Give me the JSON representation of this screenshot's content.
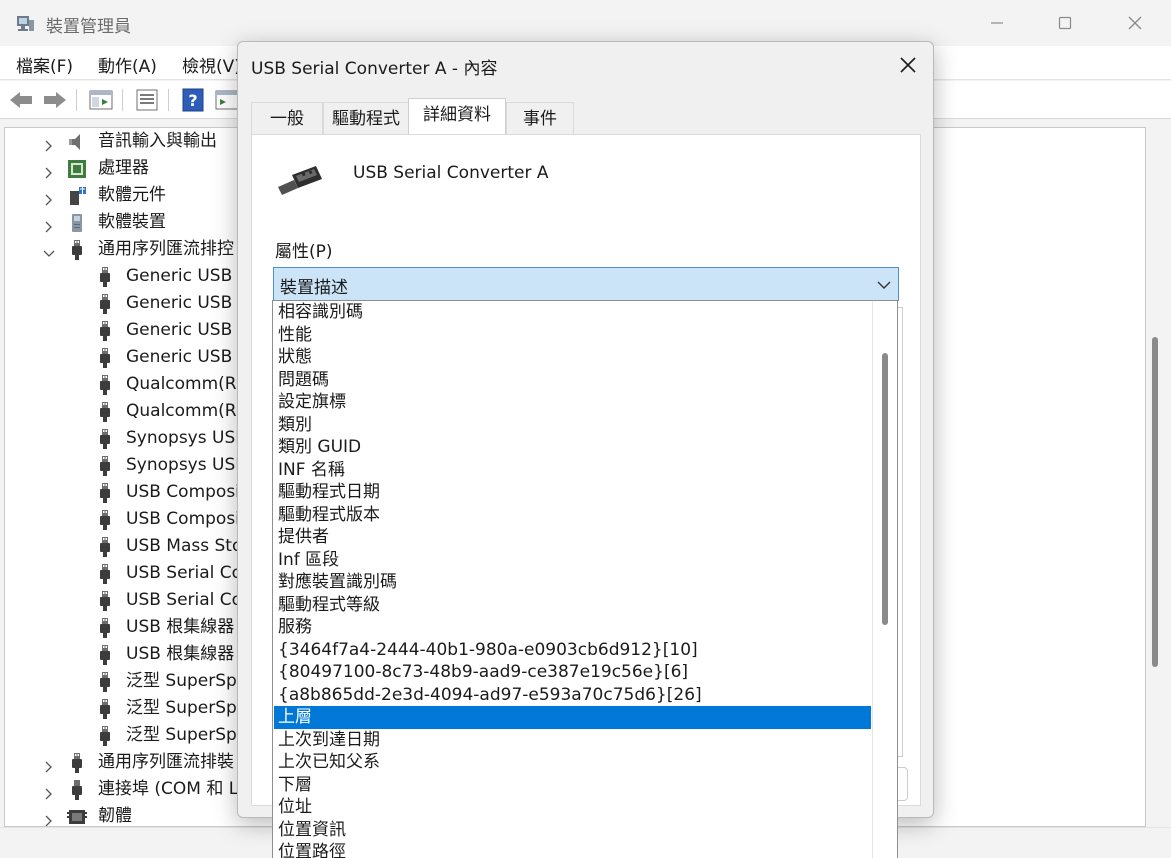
{
  "window": {
    "title": "裝置管理員"
  },
  "menubar": {
    "items": [
      "檔案(F)",
      "動作(A)",
      "檢視(V)"
    ]
  },
  "tree": {
    "rows": [
      {
        "label": "音訊輸入與輸出",
        "expand": "collapsed",
        "icon": "speaker-icon",
        "level": 0
      },
      {
        "label": "處理器",
        "expand": "collapsed",
        "icon": "processor-icon",
        "level": 0
      },
      {
        "label": "軟體元件",
        "expand": "collapsed",
        "icon": "software-component-icon",
        "level": 0
      },
      {
        "label": "軟體裝置",
        "expand": "collapsed",
        "icon": "software-device-icon",
        "level": 0
      },
      {
        "label": "通用序列匯流排控",
        "expand": "expanded",
        "icon": "usb-plug-icon",
        "level": 0
      },
      {
        "label": "Generic USB H",
        "expand": "none",
        "icon": "usb-plug-icon",
        "level": 1
      },
      {
        "label": "Generic USB H",
        "expand": "none",
        "icon": "usb-plug-icon",
        "level": 1
      },
      {
        "label": "Generic USB H",
        "expand": "none",
        "icon": "usb-plug-icon",
        "level": 1
      },
      {
        "label": "Generic USB H",
        "expand": "none",
        "icon": "usb-plug-icon",
        "level": 1
      },
      {
        "label": "Qualcomm(R)",
        "expand": "none",
        "icon": "usb-plug-icon",
        "level": 1
      },
      {
        "label": "Qualcomm(R)",
        "expand": "none",
        "icon": "usb-plug-icon",
        "level": 1
      },
      {
        "label": "Synopsys USB",
        "expand": "none",
        "icon": "usb-plug-icon",
        "level": 1
      },
      {
        "label": "Synopsys USB",
        "expand": "none",
        "icon": "usb-plug-icon",
        "level": 1
      },
      {
        "label": "USB Composi",
        "expand": "none",
        "icon": "usb-plug-icon",
        "level": 1
      },
      {
        "label": "USB Composi",
        "expand": "none",
        "icon": "usb-plug-icon",
        "level": 1
      },
      {
        "label": "USB Mass Sto",
        "expand": "none",
        "icon": "usb-plug-icon",
        "level": 1
      },
      {
        "label": "USB Serial Co",
        "expand": "none",
        "icon": "usb-plug-icon",
        "level": 1
      },
      {
        "label": "USB Serial Co",
        "expand": "none",
        "icon": "usb-plug-icon",
        "level": 1
      },
      {
        "label": "USB 根集線器",
        "expand": "none",
        "icon": "usb-plug-icon",
        "level": 1
      },
      {
        "label": "USB 根集線器",
        "expand": "none",
        "icon": "usb-plug-icon",
        "level": 1
      },
      {
        "label": "泛型 SuperSpe",
        "expand": "none",
        "icon": "usb-plug-icon",
        "level": 1
      },
      {
        "label": "泛型 SuperSpe",
        "expand": "none",
        "icon": "usb-plug-icon",
        "level": 1
      },
      {
        "label": "泛型 SuperSpe",
        "expand": "none",
        "icon": "usb-plug-icon",
        "level": 1
      },
      {
        "label": "通用序列匯流排裝",
        "expand": "collapsed",
        "icon": "usb-plug-icon",
        "level": 0
      },
      {
        "label": "連接埠 (COM 和 L",
        "expand": "collapsed",
        "icon": "port-icon",
        "level": 0
      },
      {
        "label": "韌體",
        "expand": "collapsed",
        "icon": "firmware-icon",
        "level": 0
      }
    ]
  },
  "dialog": {
    "title": "USB Serial Converter A - 內容",
    "tabs": [
      "一般",
      "驅動程式",
      "詳細資料",
      "事件"
    ],
    "active_tab": 2,
    "device_name": "USB Serial Converter A",
    "property_label": "屬性(P)",
    "selected_property": "裝置描述"
  },
  "dropdown": {
    "selected_index": 18,
    "items": [
      "相容識別碼",
      "性能",
      "狀態",
      "問題碼",
      "設定旗標",
      "類別",
      "類別 GUID",
      "INF 名稱",
      "驅動程式日期",
      "驅動程式版本",
      "提供者",
      "Inf 區段",
      "對應裝置識別碼",
      "驅動程式等級",
      "服務",
      "{3464f7a4-2444-40b1-980a-e0903cb6d912}[10]",
      "{80497100-8c73-48b9-aad9-ce387e19c56e}[6]",
      "{a8b865dd-2e3d-4094-ad97-e593a70c75d6}[26]",
      "上層",
      "上次到達日期",
      "上次已知父系",
      "下層",
      "位址",
      "位置資訊",
      "位置路徑"
    ]
  },
  "colors": {
    "selection": "#0078d7",
    "combo_fill": "#cce4f7",
    "combo_border": "#4f8fcb"
  }
}
